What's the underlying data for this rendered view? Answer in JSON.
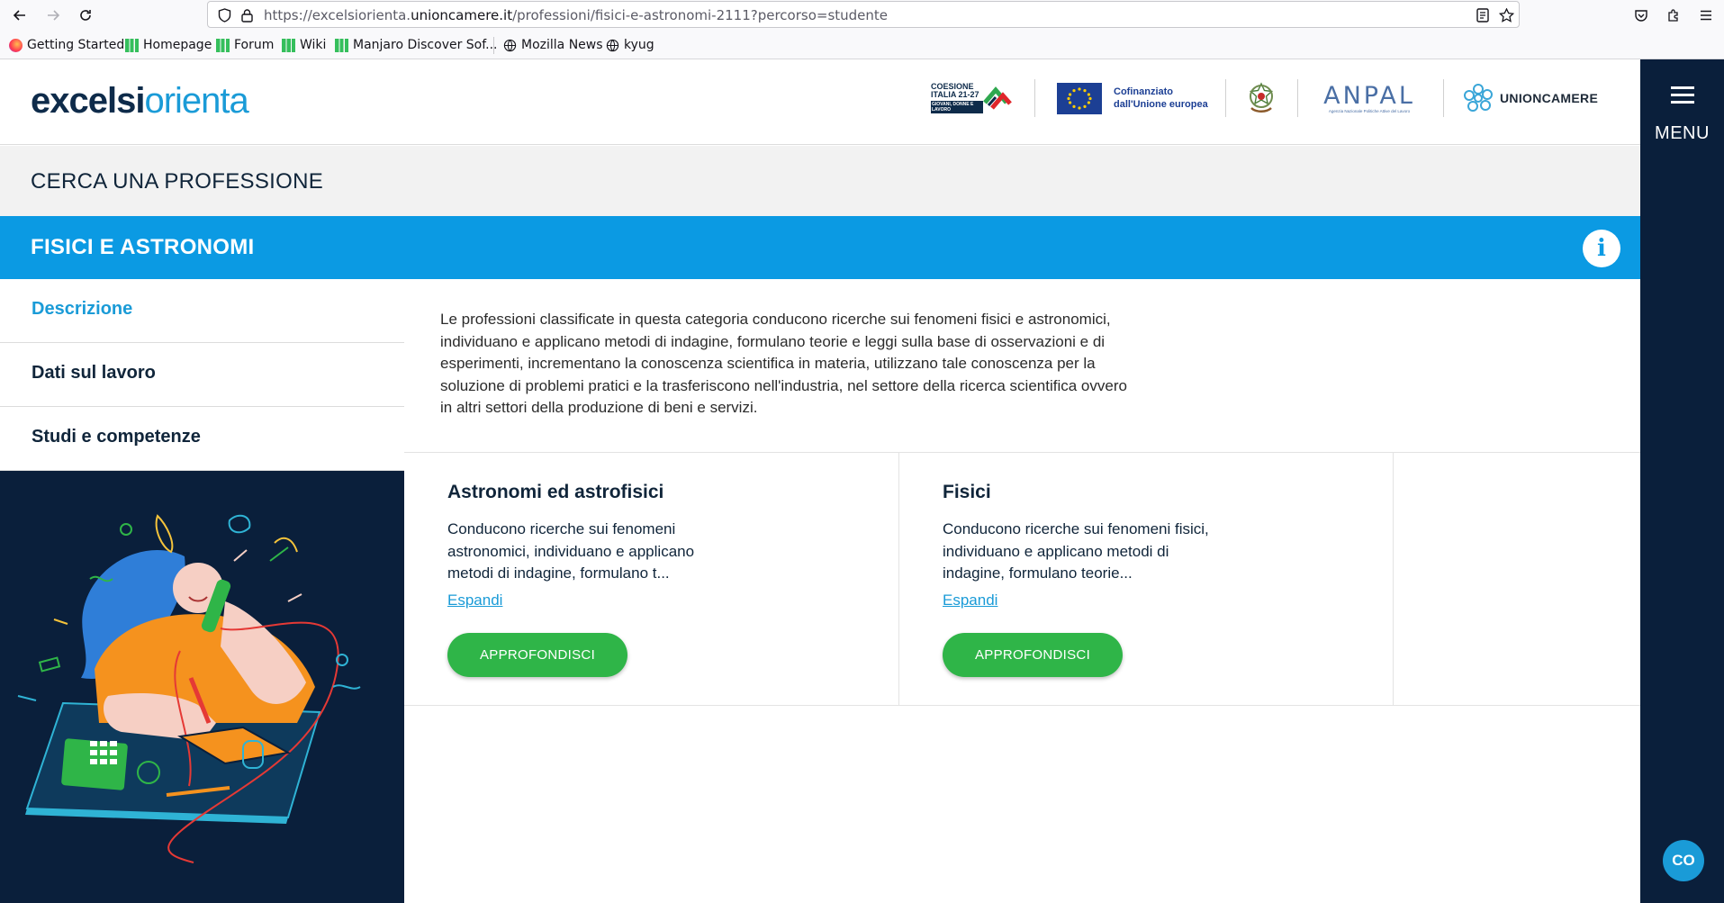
{
  "browser": {
    "url_prefix": "https://excelsiorienta.",
    "url_domain": "unioncamere.it",
    "url_path": "/professioni/fisici-e-astronomi-2111?percorso=studente",
    "bookmarks": [
      "Getting Started",
      "Homepage",
      "Forum",
      "Wiki",
      "Manjaro Discover Sof...",
      "Mozilla News",
      "kyug"
    ]
  },
  "header": {
    "logo_part1": "excelsi",
    "logo_part2": "orienta",
    "partners": {
      "coesione_line1": "COESIONE",
      "coesione_line2": "ITALIA 21-27",
      "coesione_line3": "GIOVANI, DONNE E LAVORO",
      "eu_line1": "Cofinanziato",
      "eu_line2": "dall'Unione europea",
      "anpal": "ANPAL",
      "anpal_sub": "Agenzia Nazionale Politiche Attive del Lavoro",
      "unioncamere": "UNIONCAMERE"
    },
    "menu_label": "MENU",
    "chat_label": "CO"
  },
  "page": {
    "search_title": "CERCA UNA PROFESSIONE",
    "profession_title": "FISICI E ASTRONOMI",
    "info_label": "i",
    "tabs": [
      {
        "label": "Descrizione",
        "active": true
      },
      {
        "label": "Dati sul lavoro",
        "active": false
      },
      {
        "label": "Studi e competenze",
        "active": false
      }
    ],
    "description": "Le professioni classificate in questa categoria conducono ricerche sui fenomeni fisici e astronomici, individuano e applicano metodi di indagine, formulano teorie e leggi sulla base di osservazioni e di esperimenti, incrementano la conoscenza scientifica in materia, utilizzano tale conoscenza per la soluzione di problemi pratici e la trasferiscono nell'industria, nel settore della ricerca scientifica ovvero in altri settori della produzione di beni e servizi.",
    "cards": [
      {
        "title": "Astronomi ed astrofisici",
        "text": "Conducono ricerche sui fenomeni astronomici, individuano e applicano metodi di indagine, formulano t...",
        "link": "Espandi",
        "button": "APPROFONDISCI"
      },
      {
        "title": "Fisici",
        "text": "Conducono ricerche sui fenomeni fisici, individuano e applicano metodi di indagine, formulano teorie...",
        "link": "Espandi",
        "button": "APPROFONDISCI"
      }
    ]
  },
  "colors": {
    "brand_blue": "#0b9ae3",
    "navy": "#0a1f3b",
    "button_green": "#2fb548",
    "link_blue": "#1a9bd7"
  }
}
